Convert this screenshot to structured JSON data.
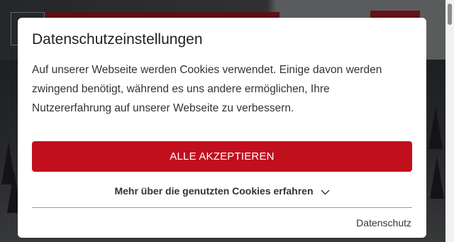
{
  "modal": {
    "title": "Datenschutzeinstellungen",
    "text": "Auf unserer Webseite werden Cookies verwendet. Einige davon werden zwingend benötigt, während es uns andere ermöglichen, Ihre Nutzererfahrung auf unserer Webseite zu verbessern.",
    "accept_all_label": "ALLE AKZEPTIEREN",
    "more_info_label": "Mehr über die genutzten Cookies erfahren",
    "more_info_icon": "chevron-down-icon",
    "privacy_label": "Datenschutz"
  },
  "colors": {
    "accent": "#c10f1e",
    "modal_bg": "#ffffff",
    "text": "#333333"
  }
}
